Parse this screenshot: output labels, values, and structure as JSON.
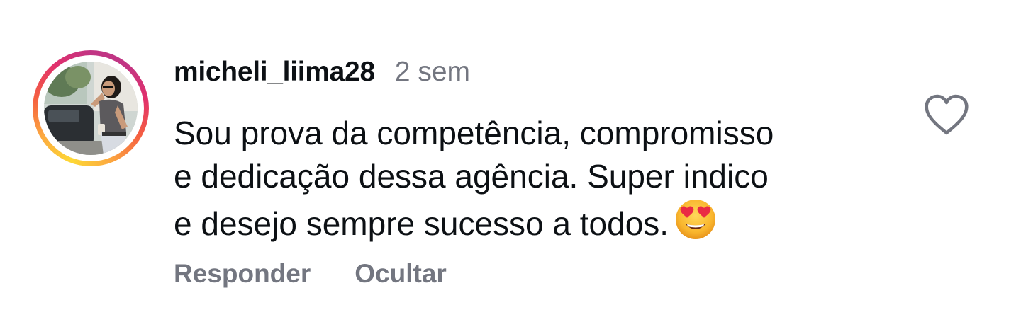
{
  "comment": {
    "username": "micheli_liima28",
    "time": "2 sem",
    "text_lines": [
      "Sou prova da competência, compromisso",
      "e dedicação dessa agência. Super indico",
      "e desejo sempre sucesso a todos."
    ],
    "emoji": "heart-eyes-emoji",
    "avatar_icon": "profile-photo",
    "like_icon": "heart-outline-icon"
  },
  "actions": {
    "reply_label": "Responder",
    "hide_label": "Ocultar"
  },
  "colors": {
    "text": "#0c1014",
    "secondary": "#737680",
    "story_ring": [
      "#fdd835",
      "#f56040",
      "#c13584"
    ]
  }
}
